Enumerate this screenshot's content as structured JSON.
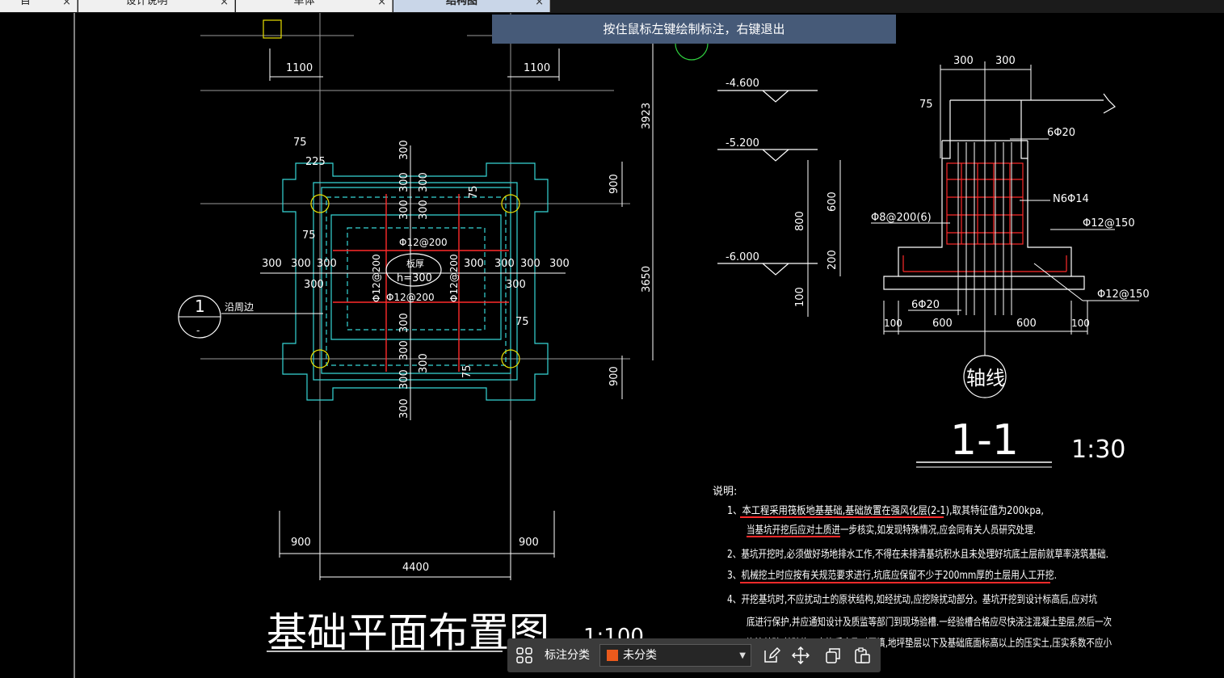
{
  "tabs": [
    {
      "label": "目",
      "active": false
    },
    {
      "label": "设计说明",
      "active": false
    },
    {
      "label": "单体",
      "active": false
    },
    {
      "label": "结构图",
      "active": true
    }
  ],
  "tab_close_glyph": "×",
  "tooltip": "按住鼠标左键绘制标注，右键退出",
  "plan": {
    "title": "基础平面布置图",
    "scale": "1:100",
    "dims": {
      "top_left": "1100",
      "top_right": "1100",
      "right_top": "3923",
      "right_mid": "3650",
      "right_900_top": "900",
      "right_900_bot": "900",
      "bottom_left": "900",
      "bottom_right": "900",
      "bottom_total": "4400",
      "d75a": "75",
      "d225": "225",
      "d75b": "75",
      "d75c": "75",
      "d75d": "75",
      "d75e": "75",
      "row300": [
        "300",
        "300",
        "300",
        "300",
        "300",
        "300"
      ],
      "d300_left": "300",
      "d300_right": "300",
      "v300_top": "300",
      "v300_a": "300",
      "v300_b": "300",
      "v300_c": "300",
      "v300_d": "300",
      "v300_e": "300",
      "v300_f": "300",
      "v300_g": "300"
    },
    "rebar_h_top": "Φ12@200",
    "rebar_h_bot": "Φ12@200",
    "rebar_v_left": "Φ12@200",
    "rebar_v_right": "Φ12@200",
    "slab_label": "板厚",
    "slab_thickness": "h=300",
    "section_mark_num": "1",
    "section_mark_sub": "-",
    "section_note": "沿周边"
  },
  "section": {
    "title": "1-1",
    "scale": "1:30",
    "axis_label": "轴线",
    "levels": [
      "-4.600",
      "-5.200",
      "-6.000"
    ],
    "dims": {
      "top_a": "300",
      "top_b": "300",
      "d75": "75",
      "v800": "800",
      "v600": "600",
      "v200": "200",
      "v100": "100",
      "b100a": "100",
      "b600a": "600",
      "b600b": "600",
      "b100b": "100"
    },
    "rebar_top": "6Φ20",
    "rebar_side": "N6Φ14",
    "stirrup": "Φ8@200(6)",
    "rebar_r1": "Φ12@150",
    "rebar_r2": "Φ12@150",
    "rebar_bottom": "6Φ20"
  },
  "notes": {
    "heading": "说明:",
    "lines": [
      "1、本工程采用筏板地基基础,基础放置在强风化层(2-1),取其特征值为200kpa,",
      "当基坑开挖后应对土质进一步核实,如发现特殊情况,应会同有关人员研究处理.",
      "2、基坑开挖时,必须做好场地排水工作,不得在未排清基坑积水且未处理好坑底土层前就草率浇筑基础.",
      "3、机械挖土时应按有关规范要求进行,坑底应保留不少于200mm厚的土层用人工开挖.",
      "4、开挖基坑时,不应扰动土的原状结构,如经扰动,应挖除扰动部分。基坑开挖到设计标高后,应对坑",
      "底进行保护,并应通知设计及质监等部门到现场验槽.一经验槽合格应尽快浇注混凝土垫层,然后一次",
      "浇注基础.基础施工完毕后应及时回填,地坪垫层以下及基础底面标高以上的压实土,压实系数不应小"
    ]
  },
  "toolbar": {
    "category_label": "标注分类",
    "category_value": "未分类",
    "swatch_color": "#ea5a1c"
  },
  "colors": {
    "cyan": "#36d6d6",
    "white": "#ffffff",
    "red": "#ff2a2a",
    "yellow": "#e8e000",
    "dim_tick": "#6a6aff",
    "tooltip_bg": "#465a78"
  }
}
